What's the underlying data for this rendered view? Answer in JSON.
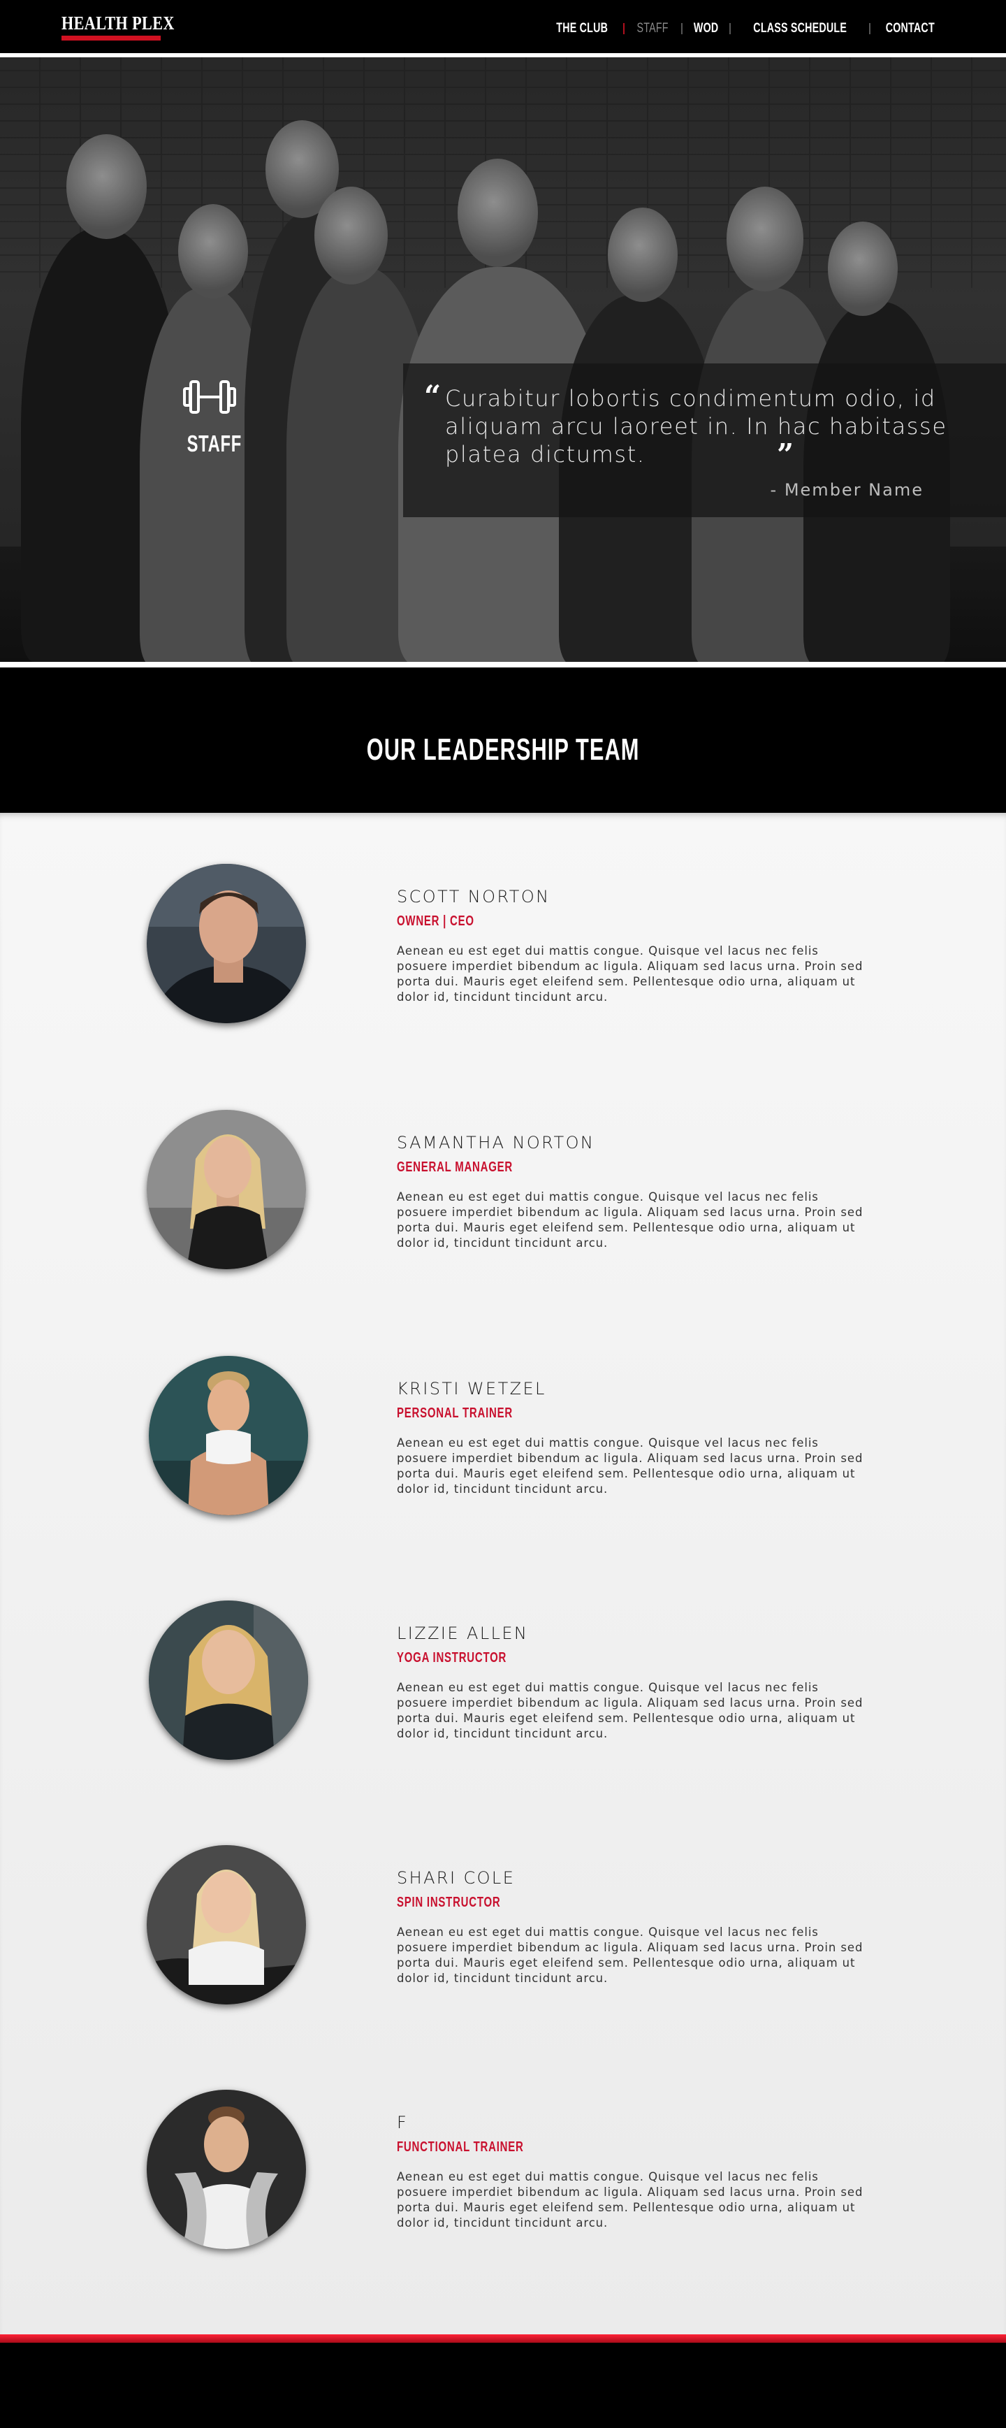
{
  "header": {
    "logo_text": "HEALTH PLEX",
    "nav": [
      {
        "label": "THE CLUB",
        "active": false
      },
      {
        "label": "STAFF",
        "active": true
      },
      {
        "label": "WOD",
        "active": false
      },
      {
        "label": "CLASS SCHEDULE",
        "active": false
      },
      {
        "label": "CONTACT",
        "active": false
      }
    ]
  },
  "hero": {
    "badge_icon": "dumbbell-icon",
    "badge_label": "STAFF",
    "quote_text": "Curabitur lobortis condimentum odio, id aliquam arcu laoreet in. In hac habitasse platea dictumst.",
    "quote_open": "“",
    "quote_close": "”",
    "quote_author": "- Member Name"
  },
  "team": {
    "title": "OUR LEADERSHIP TEAM",
    "members": [
      {
        "name": "SCOTT NORTON",
        "role": "OWNER | CEO",
        "bio": "Aenean eu est eget dui mattis congue. Quisque vel lacus nec felis posuere imperdiet bibendum ac ligula. Aliquam sed lacus urna. Proin sed porta dui. Mauris eget eleifend sem. Pellentesque odio urna, aliquam ut dolor id, tincidunt tincidunt arcu."
      },
      {
        "name": "SAMANTHA NORTON",
        "role": "GENERAL MANAGER",
        "bio": "Aenean eu est eget dui mattis congue. Quisque vel lacus nec felis posuere imperdiet bibendum ac ligula. Aliquam sed lacus urna. Proin sed porta dui. Mauris eget eleifend sem. Pellentesque odio urna, aliquam ut dolor id, tincidunt tincidunt arcu."
      },
      {
        "name": "KRISTI WETZEL",
        "role": "PERSONAL TRAINER",
        "bio": "Aenean eu est eget dui mattis congue. Quisque vel lacus nec felis posuere imperdiet bibendum ac ligula. Aliquam sed lacus urna. Proin sed porta dui. Mauris eget eleifend sem. Pellentesque odio urna, aliquam ut dolor id, tincidunt tincidunt arcu."
      },
      {
        "name": "LIZZIE ALLEN",
        "role": "YOGA INSTRUCTOR",
        "bio": "Aenean eu est eget dui mattis congue. Quisque vel lacus nec felis posuere imperdiet bibendum ac ligula. Aliquam sed lacus urna. Proin sed porta dui. Mauris eget eleifend sem. Pellentesque odio urna, aliquam ut dolor id, tincidunt tincidunt arcu."
      },
      {
        "name": "SHARI COLE",
        "role": "SPIN INSTRUCTOR",
        "bio": "Aenean eu est eget dui mattis congue. Quisque vel lacus nec felis posuere imperdiet bibendum ac ligula. Aliquam sed lacus urna. Proin sed porta dui. Mauris eget eleifend sem. Pellentesque odio urna, aliquam ut dolor id, tincidunt tincidunt arcu."
      },
      {
        "name": "F",
        "role": "FUNCTIONAL TRAINER",
        "bio": "Aenean eu est eget dui mattis congue. Quisque vel lacus nec felis posuere imperdiet bibendum ac ligula. Aliquam sed lacus urna. Proin sed porta dui. Mauris eget eleifend sem. Pellentesque odio urna, aliquam ut dolor id, tincidunt tincidunt arcu."
      }
    ]
  },
  "colors": {
    "accent_red": "#c8102e",
    "background_dark": "#000000",
    "nav_active": "#8a8a8a"
  }
}
